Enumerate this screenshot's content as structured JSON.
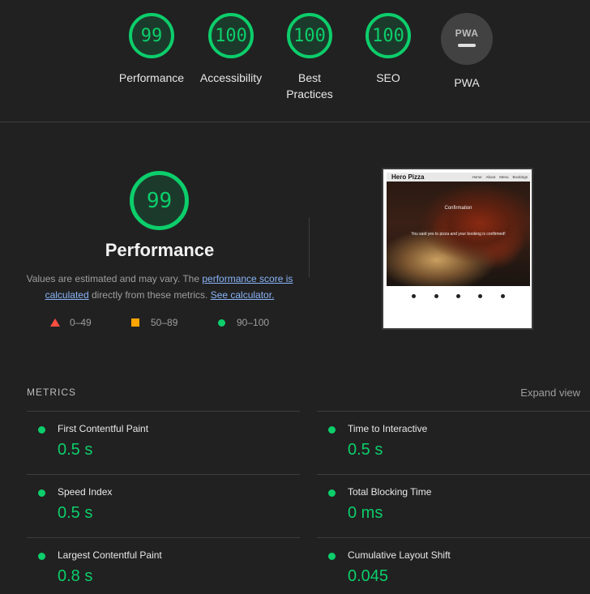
{
  "scores": [
    {
      "value": "99",
      "label": "Performance"
    },
    {
      "value": "100",
      "label": "Accessibility"
    },
    {
      "value": "100",
      "label": "Best\nPractices"
    },
    {
      "value": "100",
      "label": "SEO"
    }
  ],
  "pwa": {
    "badge": "PWA",
    "label": "PWA"
  },
  "performance": {
    "score": "99",
    "title": "Performance",
    "desc_prefix": "Values are estimated and may vary. The ",
    "link_score": "performance score is calculated",
    "desc_mid": " directly from these metrics. ",
    "link_calc": "See calculator."
  },
  "legend": [
    {
      "range": "0–49",
      "color": "#ff4e42"
    },
    {
      "range": "50–89",
      "color": "#ffa400"
    },
    {
      "range": "90–100",
      "color": "#0cce6b"
    }
  ],
  "thumbnail": {
    "brand": "Hero Pizza",
    "nav": [
      "Home",
      "About",
      "Menu",
      "Bookings"
    ],
    "heading": "Confirmation",
    "message": "You said yes to pizza and your booking is confirmed!",
    "social_icons": [
      "facebook-icon",
      "twitter-icon",
      "tiktok-icon",
      "youtube-icon",
      "instagram-icon"
    ]
  },
  "metrics": {
    "heading": "METRICS",
    "expand": "Expand view",
    "items": [
      {
        "name": "First Contentful Paint",
        "value": "0.5 s"
      },
      {
        "name": "Time to Interactive",
        "value": "0.5 s"
      },
      {
        "name": "Speed Index",
        "value": "0.5 s"
      },
      {
        "name": "Total Blocking Time",
        "value": "0 ms"
      },
      {
        "name": "Largest Contentful Paint",
        "value": "0.8 s"
      },
      {
        "name": "Cumulative Layout Shift",
        "value": "0.045"
      }
    ]
  },
  "colors": {
    "pass": "#0cce6b",
    "average": "#ffa400",
    "fail": "#ff4e42",
    "background": "#212121"
  }
}
